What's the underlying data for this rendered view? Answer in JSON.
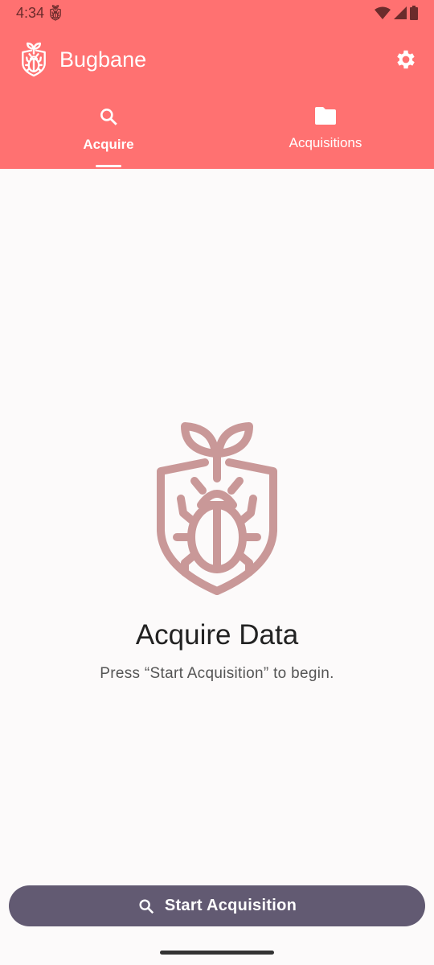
{
  "status_bar": {
    "time": "4:34",
    "icons": [
      "bugbane-notification-icon",
      "wifi-icon",
      "signal-icon",
      "battery-icon"
    ]
  },
  "app_bar": {
    "title": "Bugbane",
    "settings_icon": "gear-icon"
  },
  "tabs": [
    {
      "label": "Acquire",
      "icon": "search-icon",
      "active": true
    },
    {
      "label": "Acquisitions",
      "icon": "folder-icon",
      "active": false
    }
  ],
  "main": {
    "heading": "Acquire Data",
    "subtitle": "Press “Start Acquisition” to begin."
  },
  "action": {
    "label": "Start Acquisition",
    "icon": "search-icon"
  },
  "colors": {
    "header": "#ff7171",
    "button": "#625a72",
    "logo": "#c99898"
  }
}
